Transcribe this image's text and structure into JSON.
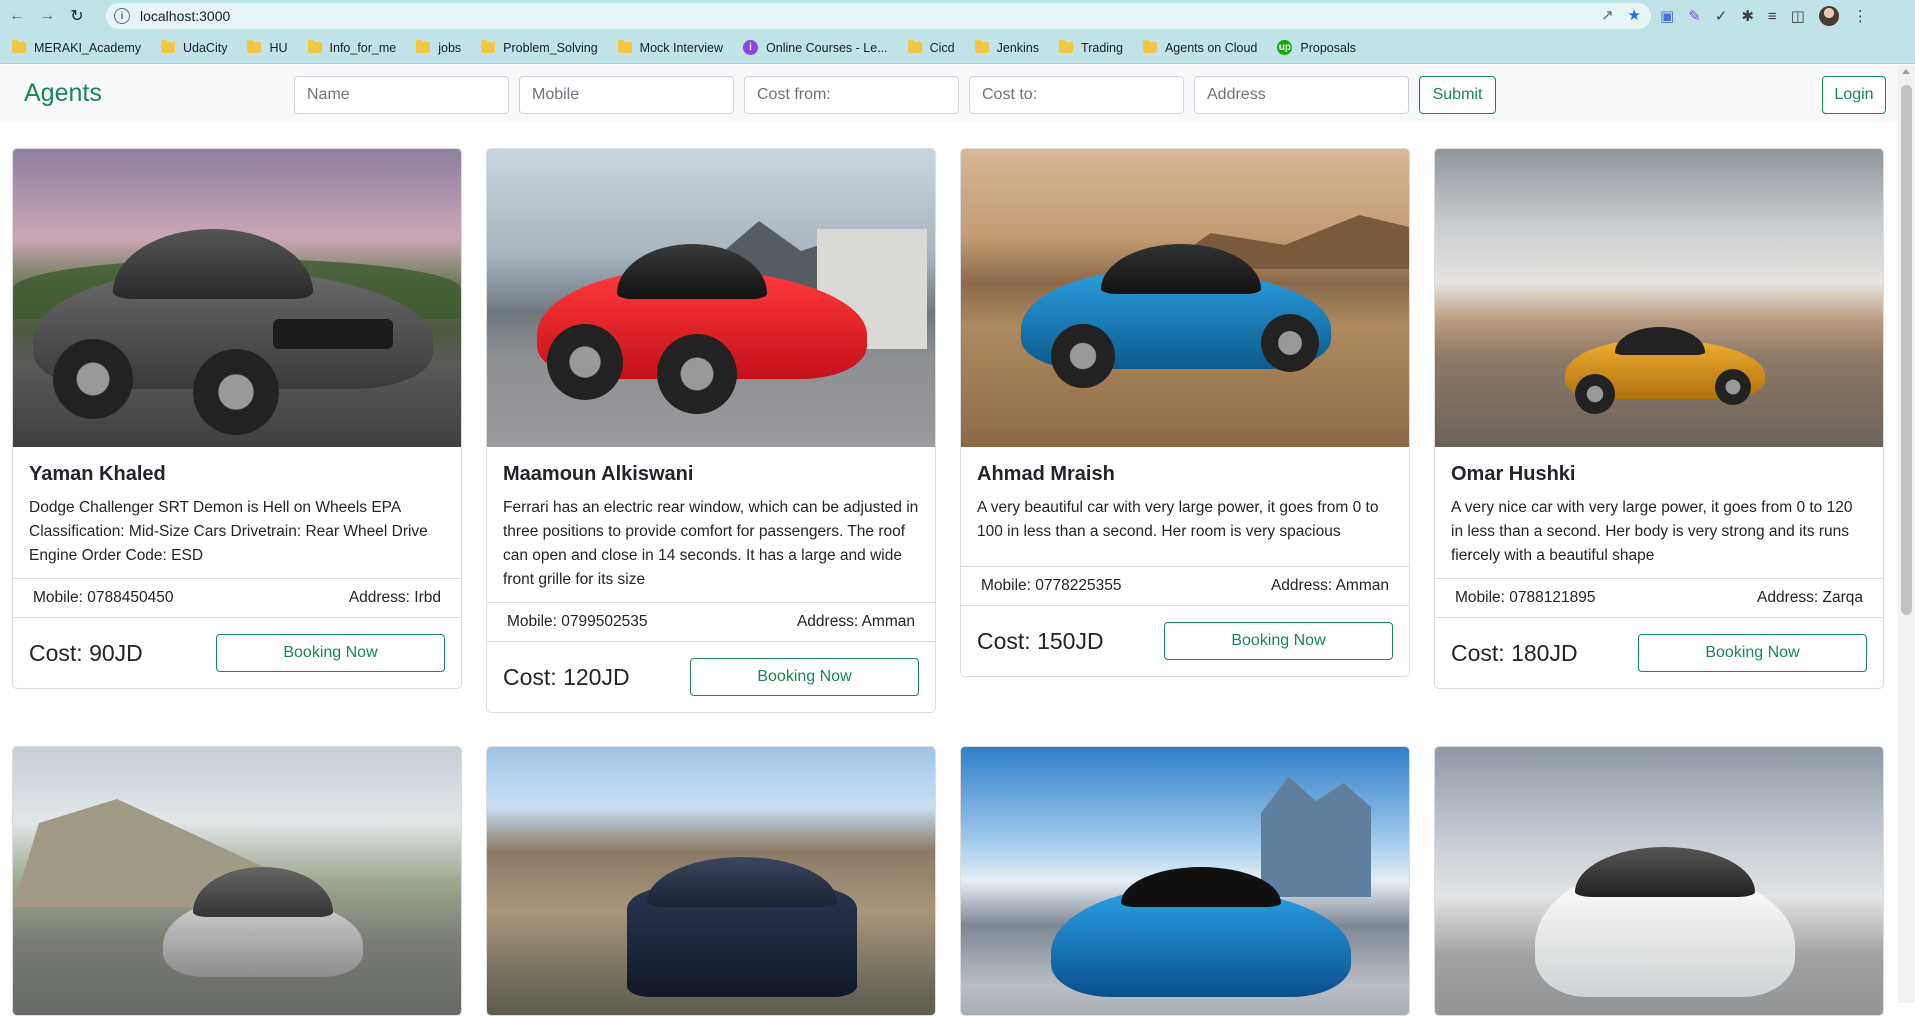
{
  "browser": {
    "url": "localhost:3000",
    "bookmarks": [
      {
        "label": "MERAKI_Academy",
        "icon": "folder-icon"
      },
      {
        "label": "UdaCity",
        "icon": "folder-icon"
      },
      {
        "label": "HU",
        "icon": "folder-icon"
      },
      {
        "label": "Info_for_me",
        "icon": "folder-icon"
      },
      {
        "label": "jobs",
        "icon": "folder-icon"
      },
      {
        "label": "Problem_Solving",
        "icon": "folder-icon"
      },
      {
        "label": "Mock Interview",
        "icon": "folder-icon"
      },
      {
        "label": "Online Courses - Le...",
        "icon": "courses-icon"
      },
      {
        "label": "Cicd",
        "icon": "folder-icon"
      },
      {
        "label": "Jenkins",
        "icon": "folder-icon"
      },
      {
        "label": "Trading",
        "icon": "folder-icon"
      },
      {
        "label": "Agents on Cloud",
        "icon": "folder-icon"
      },
      {
        "label": "Proposals",
        "icon": "upwork-icon"
      }
    ]
  },
  "navbar": {
    "brand": "Agents",
    "name_placeholder": "Name",
    "mobile_placeholder": "Mobile",
    "cost_from_placeholder": "Cost from:",
    "cost_to_placeholder": "Cost to:",
    "address_placeholder": "Address",
    "submit_label": "Submit",
    "login_label": "Login"
  },
  "colors": {
    "brand_green": "#198754",
    "chrome_teal": "#bfe3e6"
  },
  "cards": [
    {
      "name": "Yaman Khaled",
      "description": "Dodge Challenger SRT Demon is Hell on Wheels EPA Classification: Mid-Size Cars Drivetrain: Rear Wheel Drive Engine Order Code: ESD",
      "mobile": "Mobile: 0788450450",
      "address": "Address: Irbd",
      "cost": "Cost: 90JD",
      "button": "Booking Now"
    },
    {
      "name": "Maamoun Alkiswani",
      "description": "Ferrari has an electric rear window, which can be adjusted in three positions to provide comfort for passengers. The roof can open and close in 14 seconds. It has a large and wide front grille for its size",
      "mobile": "Mobile: 0799502535",
      "address": "Address: Amman",
      "cost": "Cost: 120JD",
      "button": "Booking Now"
    },
    {
      "name": "Ahmad Mraish",
      "description": "A very beautiful car with very large power, it goes from 0 to 100 in less than a second. Her room is very spacious",
      "mobile": "Mobile: 0778225355",
      "address": "Address: Amman",
      "cost": "Cost: 150JD",
      "button": "Booking Now"
    },
    {
      "name": "Omar Hushki",
      "description": "A very nice car with very large power, it goes from 0 to 120 in less than a second. Her body is very strong and its runs fiercely with a beautiful shape",
      "mobile": "Mobile: 0788121895",
      "address": "Address: Zarqa",
      "cost": "Cost: 180JD",
      "button": "Booking Now"
    }
  ]
}
